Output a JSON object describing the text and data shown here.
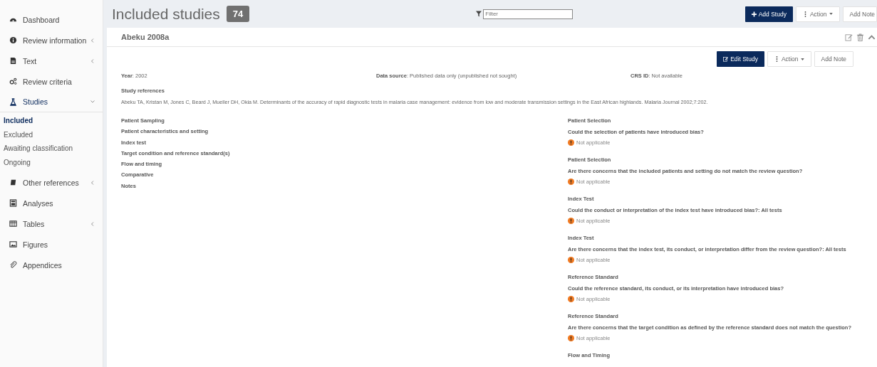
{
  "sidebar": {
    "items": [
      {
        "label": "Dashboard",
        "expandable": false,
        "expanded": false,
        "selected": false
      },
      {
        "label": "Review information",
        "expandable": true,
        "expanded": false,
        "selected": false
      },
      {
        "label": "Text",
        "expandable": true,
        "expanded": false,
        "selected": false
      },
      {
        "label": "Review criteria",
        "expandable": false,
        "expanded": false,
        "selected": false
      },
      {
        "label": "Studies",
        "expandable": true,
        "expanded": true,
        "selected": true,
        "children": [
          {
            "label": "Included",
            "selected": true
          },
          {
            "label": "Excluded",
            "selected": false
          },
          {
            "label": "Awaiting classification",
            "selected": false
          },
          {
            "label": "Ongoing",
            "selected": false
          }
        ]
      },
      {
        "label": "Other references",
        "expandable": true,
        "expanded": false,
        "selected": false
      },
      {
        "label": "Analyses",
        "expandable": false,
        "expanded": false,
        "selected": false
      },
      {
        "label": "Tables",
        "expandable": true,
        "expanded": false,
        "selected": false
      },
      {
        "label": "Figures",
        "expandable": false,
        "expanded": false,
        "selected": false
      },
      {
        "label": "Appendices",
        "expandable": false,
        "expanded": false,
        "selected": false
      }
    ]
  },
  "header": {
    "title": "Included studies",
    "count": "74",
    "filter": {
      "placeholder": "Filter"
    },
    "buttons": [
      "Add Study",
      "Action",
      "Add Note"
    ]
  },
  "study": {
    "name": "Abeku 2008a",
    "buttons": [
      "Edit Study",
      "Action",
      "Add Note"
    ],
    "fields": [
      "**Year**: 2002",
      "**Data source**: Published data only (unpublished not sought)",
      "**CRS ID**: Not available"
    ],
    "references_title": "Study references",
    "reference": "Abeku TA, Kristan M, Jones C, Beard J, Mueller DH, Okia M. Determinants of the accuracy of rapid diagnostic tests in malaria case management: evidence from low and moderate transmission settings in the East African highlands. Malaria Journal 2002;7:202.",
    "sections": [
      "Patient Sampling",
      "Patient characteristics and setting",
      "Index test",
      "Target condition and reference standard(s)",
      "Flow and timing",
      "Comparative",
      "Notes"
    ],
    "assessments": [
      {
        "domain": "Patient Selection",
        "question": "Could the selection of patients have introduced bias?",
        "answer": "Not applicable",
        "color": "#f07a22"
      },
      {
        "domain": "Patient Selection",
        "question": "Are there concerns that the included patients and setting do not match the review question?",
        "answer": "Not applicable",
        "color": "#f07a22"
      },
      {
        "domain": "Index Test",
        "question": "Could the conduct or interpretation of the index test have introduced bias?: All tests",
        "answer": "Not applicable",
        "color": "#f07a22"
      },
      {
        "domain": "Index Test",
        "question": "Are there concerns that the index test, its conduct, or interpretation differ from the review question?: All tests",
        "answer": "Not applicable",
        "color": "#f07a22"
      },
      {
        "domain": "Reference Standard",
        "question": "Could the reference standard, its conduct, or its interpretation have introduced bias?",
        "answer": "Not applicable",
        "color": "#f07a22"
      },
      {
        "domain": "Reference Standard",
        "question": "Are there concerns that the target condition as defined by the reference standard does not match the question?",
        "answer": "Not applicable",
        "color": "#f07a22"
      },
      {
        "domain": "Flow and Timing"
      }
    ]
  }
}
